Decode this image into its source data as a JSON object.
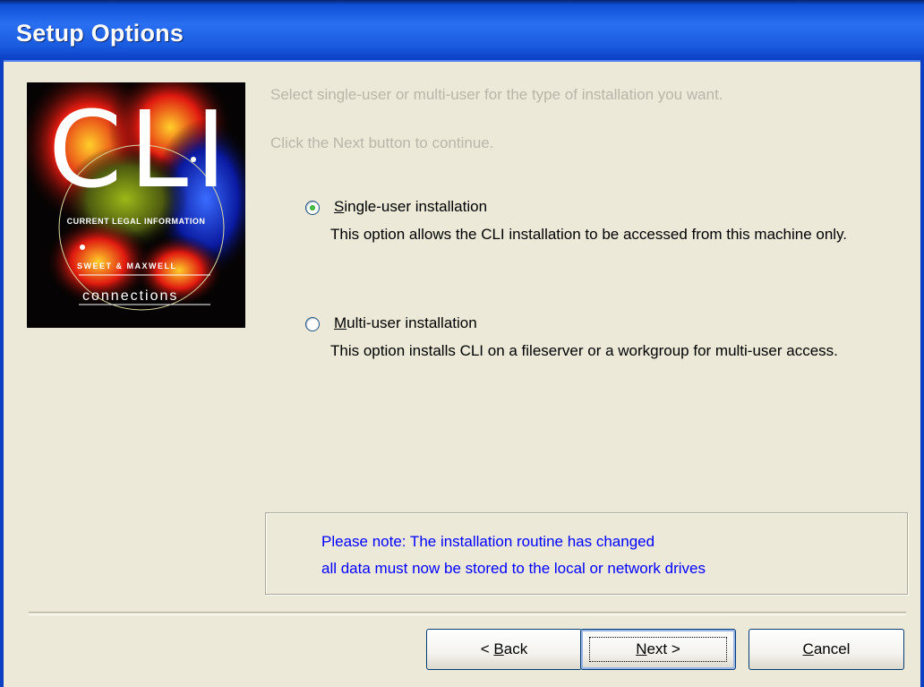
{
  "window": {
    "title": "Setup Options"
  },
  "logo": {
    "big": "CLI",
    "sub1": "CURRENT LEGAL INFORMATION",
    "sub2": "SWEET & MAXWELL",
    "sub3": "connections"
  },
  "instructions": {
    "line1": "Select single-user or multi-user for the type of installation you want.",
    "line2": "Click the Next button to continue."
  },
  "options": [
    {
      "label_mnemonic": "S",
      "label_rest": "ingle-user installation",
      "description": "This option allows the CLI installation to be accessed from this machine only.",
      "selected": true
    },
    {
      "label_mnemonic": "M",
      "label_rest": "ulti-user installation",
      "description": "This option installs CLI on a fileserver or a workgroup for multi-user access.",
      "selected": false
    }
  ],
  "note": {
    "line1": "Please note: The installation routine has changed",
    "line2": "all data must now be stored  to the local or network drives",
    "color": "#0000ff"
  },
  "buttons": {
    "back_prefix": "< ",
    "back_mnemonic": "B",
    "back_rest": "ack",
    "next_mnemonic": "N",
    "next_rest": "ext >",
    "cancel_mnemonic": "C",
    "cancel_rest": "ancel"
  }
}
